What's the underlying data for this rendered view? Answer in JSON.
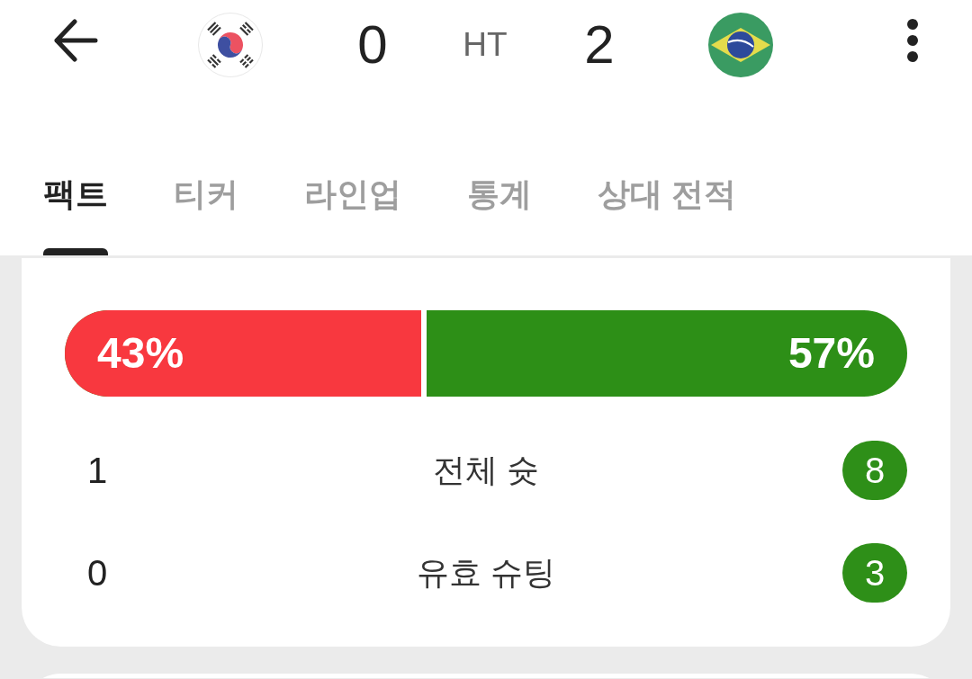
{
  "score": {
    "home": "0",
    "status": "HT",
    "away": "2"
  },
  "tabs": [
    {
      "label": "팩트",
      "selected": true
    },
    {
      "label": "티커",
      "selected": false
    },
    {
      "label": "라인업",
      "selected": false
    },
    {
      "label": "통계",
      "selected": false
    },
    {
      "label": "상대 전적",
      "selected": false
    }
  ],
  "possession": {
    "level": 0.43,
    "home_label": "43%",
    "away_label": "57%"
  },
  "stats": [
    {
      "label": "전체 슛",
      "home": {
        "value": "1",
        "highlighted": false
      },
      "away": {
        "value": "8",
        "highlighted": true
      }
    },
    {
      "label": "유효 슈팅",
      "home": {
        "value": "0",
        "highlighted": false
      },
      "away": {
        "value": "3",
        "highlighted": true
      }
    }
  ]
}
